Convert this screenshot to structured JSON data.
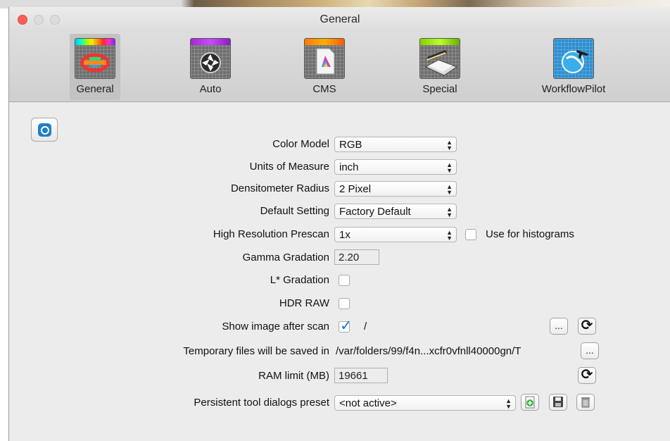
{
  "window": {
    "title": "General"
  },
  "toolbar": {
    "items": [
      {
        "label": "General",
        "icon": "color-grid-icon"
      },
      {
        "label": "Auto",
        "icon": "aperture-icon"
      },
      {
        "label": "CMS",
        "icon": "color-profile-icon"
      },
      {
        "label": "Special",
        "icon": "scanner-icon"
      },
      {
        "label": "WorkflowPilot",
        "icon": "workflow-pilot-icon"
      }
    ]
  },
  "settings": {
    "color_model": {
      "label": "Color Model",
      "value": "RGB"
    },
    "units": {
      "label": "Units of Measure",
      "value": "inch"
    },
    "densitometer": {
      "label": "Densitometer Radius",
      "value": "2 Pixel"
    },
    "default_setting": {
      "label": "Default Setting",
      "value": "Factory Default"
    },
    "prescan": {
      "label": "High Resolution Prescan",
      "value": "1x",
      "checkbox_label": "Use for histograms",
      "checked": false
    },
    "gamma": {
      "label": "Gamma Gradation",
      "value": "2.20"
    },
    "lstar": {
      "label": "L* Gradation",
      "checked": false
    },
    "hdr": {
      "label": "HDR RAW",
      "checked": false
    },
    "show_image": {
      "label": "Show image after scan",
      "checked": true,
      "path": "/",
      "browse_label": "..."
    },
    "temp_files": {
      "label": "Temporary files will be saved in",
      "path": "/var/folders/99/f4n...xcfr0vfnll40000gn/T",
      "browse_label": "..."
    },
    "ram": {
      "label": "RAM limit (MB)",
      "value": "19661"
    },
    "preset": {
      "label": "Persistent tool dialogs preset",
      "value": "<not active>"
    }
  },
  "colors": {
    "close": "#fc5f57",
    "accent": "#1a6fd6"
  }
}
